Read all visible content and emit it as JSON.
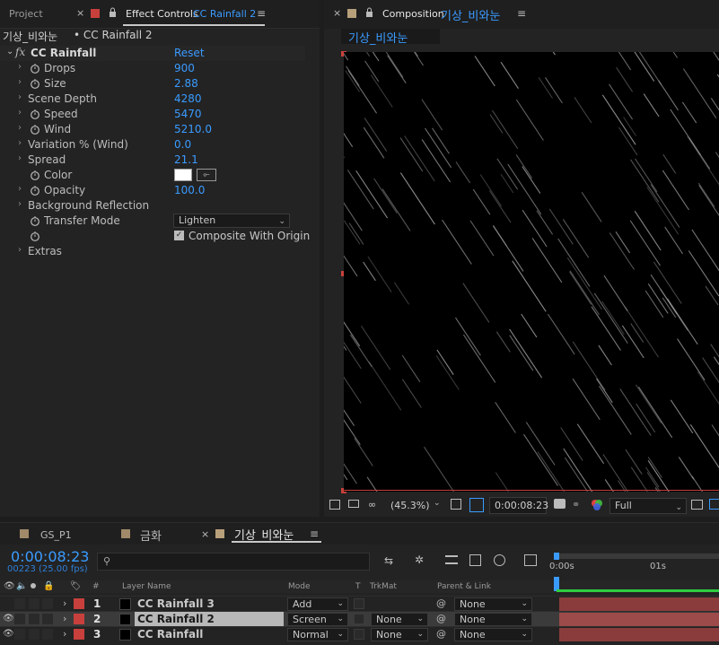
{
  "left_tabs": {
    "project": "Project",
    "effect_controls": "Effect Controls",
    "effect_layer": "CC Rainfall 2"
  },
  "ec_header": {
    "comp": "기상_비와눈",
    "sep": " • ",
    "layer": "CC Rainfall 2"
  },
  "effect": {
    "name": "CC Rainfall",
    "reset": "Reset"
  },
  "params": [
    {
      "name": "Drops",
      "value": "900"
    },
    {
      "name": "Size",
      "value": "2.88"
    },
    {
      "name": "Scene Depth",
      "value": "4280"
    },
    {
      "name": "Speed",
      "value": "5470"
    },
    {
      "name": "Wind",
      "value": "5210.0"
    },
    {
      "name": "Variation % (Wind)",
      "value": "0.0"
    },
    {
      "name": "Spread",
      "value": "21.1"
    },
    {
      "name": "Color",
      "value": ""
    },
    {
      "name": "Opacity",
      "value": "100.0"
    },
    {
      "name": "Background Reflection",
      "value": ""
    },
    {
      "name": "Transfer Mode",
      "value": "Lighten"
    },
    {
      "name": "",
      "value": "Composite With Origin"
    },
    {
      "name": "Extras",
      "value": ""
    }
  ],
  "comp_panel": {
    "label": "Composition",
    "comp_name": "기상_비와눈",
    "view_tab": "기상_비와눈"
  },
  "viewer_bottom": {
    "zoom": "(45.3%)",
    "timecode": "0:00:08:23",
    "resolution": "Full"
  },
  "timeline_tabs": [
    {
      "label": "GS_P1",
      "color": "#a08a6a"
    },
    {
      "label": "금화",
      "color": "#a08a6a"
    },
    {
      "label": "기상_비와눈",
      "color": "#b8a07a"
    }
  ],
  "timeline": {
    "current_time": "0:00:08:23",
    "frame_info": "00223 (25.00 fps)",
    "search_placeholder": "",
    "headers": {
      "hash": "#",
      "layer_name": "Layer Name",
      "mode": "Mode",
      "t": "T",
      "trkmat": "TrkMat",
      "parent": "Parent & Link"
    },
    "ruler": [
      "0:00s",
      "01s"
    ],
    "layers": [
      {
        "num": "1",
        "name": "CC Rainfall 3",
        "mode": "Add",
        "trkmat": "",
        "parent": "None"
      },
      {
        "num": "2",
        "name": "CC Rainfall 2",
        "mode": "Screen",
        "trkmat": "None",
        "parent": "None"
      },
      {
        "num": "3",
        "name": "CC Rainfall",
        "mode": "Normal",
        "trkmat": "None",
        "parent": "None"
      }
    ]
  },
  "colors": {
    "accent_blue": "#3a9bff",
    "label_red": "#c8403c",
    "selected_layer_bar": "#9c4a4a",
    "layer_bar": "#8a3c3c"
  }
}
